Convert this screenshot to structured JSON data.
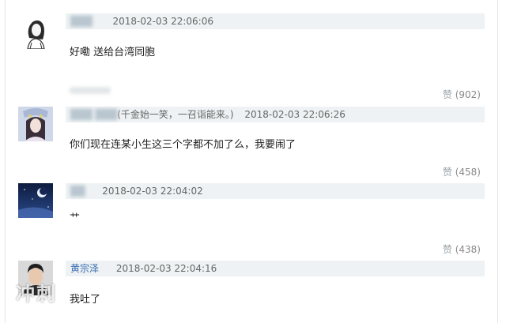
{
  "comments": [
    {
      "username": "███",
      "note": "",
      "time": "2018-02-03 22:06:06",
      "text": "好嘞 送给台湾同胞",
      "like_label": "赞",
      "like_count": "(902)"
    },
    {
      "username": "███ ███",
      "note": "(千金始一笑，一召诣能来。)",
      "time": "2018-02-03 22:06:26",
      "text": "你们现在连某小生这三个字都不加了么，我要闹了",
      "like_label": "赞",
      "like_count": "(458)"
    },
    {
      "username": "██",
      "note": "",
      "time": "2018-02-03 22:04:02",
      "text": "艹",
      "like_label": "赞",
      "like_count": "(438)"
    },
    {
      "username": "黄宗泽",
      "note": "",
      "time": "2018-02-03 22:04:16",
      "text": "我吐了",
      "like_label": "",
      "like_count": ""
    }
  ],
  "watermark": "冲刺"
}
